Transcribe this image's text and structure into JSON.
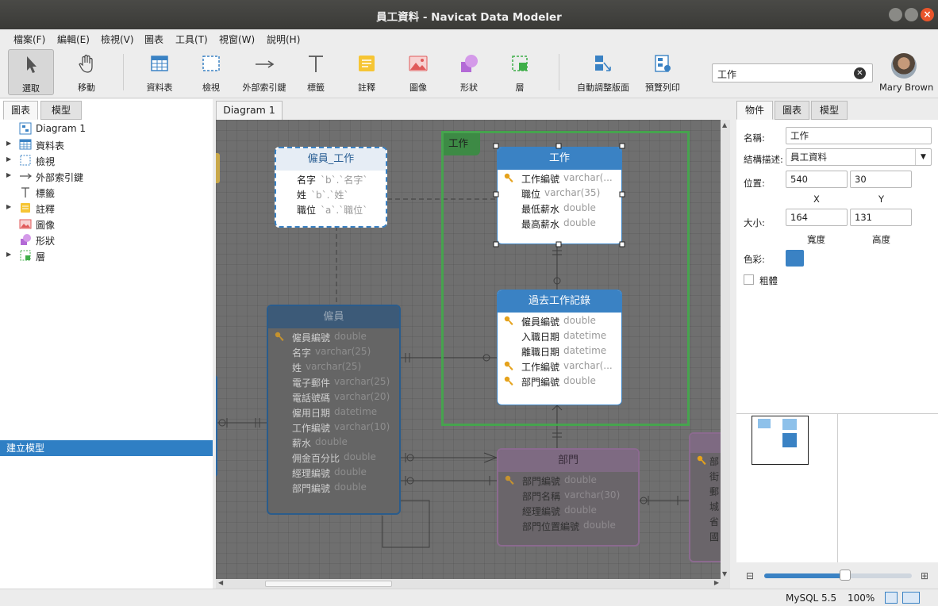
{
  "window": {
    "title": "員工資料 - Navicat Data Modeler"
  },
  "menu": [
    "檔案(F)",
    "編輯(E)",
    "檢視(V)",
    "圖表",
    "工具(T)",
    "視窗(W)",
    "說明(H)"
  ],
  "toolbar": {
    "select": "選取",
    "move": "移動",
    "table": "資料表",
    "view": "檢視",
    "foreign_key": "外部索引鍵",
    "label": "標籤",
    "note": "註釋",
    "image": "圖像",
    "shape": "形狀",
    "layer": "層",
    "auto_layout": "自動調整版面",
    "print_preview": "預覽列印",
    "search_value": "工作",
    "user": "Mary Brown"
  },
  "left_panel": {
    "tabs": [
      "圖表",
      "模型"
    ],
    "tree": [
      {
        "label": "Diagram 1",
        "icon": "diagram-icon",
        "expandable": false
      },
      {
        "label": "資料表",
        "icon": "table-icon",
        "expandable": true
      },
      {
        "label": "檢視",
        "icon": "view-icon",
        "expandable": true
      },
      {
        "label": "外部索引鍵",
        "icon": "foreign-key-icon",
        "expandable": true
      },
      {
        "label": "標籤",
        "icon": "label-icon",
        "expandable": false
      },
      {
        "label": "註釋",
        "icon": "note-icon",
        "expandable": true
      },
      {
        "label": "圖像",
        "icon": "image-icon",
        "expandable": false
      },
      {
        "label": "形狀",
        "icon": "shape-icon",
        "expandable": false
      },
      {
        "label": "層",
        "icon": "layer-icon",
        "expandable": true
      }
    ],
    "selected_item": "建立模型"
  },
  "document_tab": "Diagram 1",
  "diagram": {
    "layer_label": "工作",
    "entities": {
      "employee_job": {
        "title": "僱員_工作",
        "fields": [
          {
            "name": "名字",
            "type": "`b`.`名字`"
          },
          {
            "name": "姓",
            "type": "`b`.`姓`"
          },
          {
            "name": "職位",
            "type": "`a`.`職位`"
          }
        ]
      },
      "job": {
        "title": "工作",
        "fields": [
          {
            "name": "工作編號",
            "type": "varchar(...",
            "key": true
          },
          {
            "name": "職位",
            "type": "varchar(35)",
            "key": false
          },
          {
            "name": "最低薪水",
            "type": "double",
            "key": false
          },
          {
            "name": "最高薪水",
            "type": "double",
            "key": false
          }
        ]
      },
      "job_history": {
        "title": "過去工作記錄",
        "fields": [
          {
            "name": "僱員編號",
            "type": "double",
            "key": true
          },
          {
            "name": "入職日期",
            "type": "datetime",
            "key": false
          },
          {
            "name": "離職日期",
            "type": "datetime",
            "key": false
          },
          {
            "name": "工作編號",
            "type": "varchar(...",
            "key": true
          },
          {
            "name": "部門編號",
            "type": "double",
            "key": true
          }
        ]
      },
      "employee": {
        "title": "僱員",
        "fields": [
          {
            "name": "僱員編號",
            "type": "double",
            "key": true
          },
          {
            "name": "名字",
            "type": "varchar(25)",
            "key": false
          },
          {
            "name": "姓",
            "type": "varchar(25)",
            "key": false
          },
          {
            "name": "電子郵件",
            "type": "varchar(25)",
            "key": false
          },
          {
            "name": "電話號碼",
            "type": "varchar(20)",
            "key": false
          },
          {
            "name": "僱用日期",
            "type": "datetime",
            "key": false
          },
          {
            "name": "工作編號",
            "type": "varchar(10)",
            "key": false
          },
          {
            "name": "薪水",
            "type": "double",
            "key": false
          },
          {
            "name": "佣金百分比",
            "type": "double",
            "key": false
          },
          {
            "name": "經理編號",
            "type": "double",
            "key": false
          },
          {
            "name": "部門編號",
            "type": "double",
            "key": false
          }
        ]
      },
      "department": {
        "title": "部門",
        "fields": [
          {
            "name": "部門編號",
            "type": "double",
            "key": true
          },
          {
            "name": "部門名稱",
            "type": "varchar(30)",
            "key": false
          },
          {
            "name": "經理編號",
            "type": "double",
            "key": false
          },
          {
            "name": "部門位置編號",
            "type": "double",
            "key": false
          }
        ]
      },
      "location_partial": {
        "fields": [
          "部",
          "街",
          "郵",
          "城",
          "省",
          "國"
        ]
      }
    }
  },
  "right_panel": {
    "tabs": [
      "物件",
      "圖表",
      "模型"
    ],
    "name_label": "名稱:",
    "name_value": "工作",
    "schema_label": "結構描述:",
    "schema_value": "員工資料",
    "position_label": "位置:",
    "pos_x": "540",
    "pos_y": "30",
    "x_label": "X",
    "y_label": "Y",
    "size_label": "大小:",
    "width": "164",
    "height": "131",
    "width_label": "寬度",
    "height_label": "高度",
    "color_label": "色彩:",
    "bold_label": "粗體",
    "zoom_percent": 55
  },
  "status": {
    "db": "MySQL 5.5",
    "zoom": "100%"
  },
  "colors": {
    "accent": "#3a82c4",
    "layer_border": "#3fae49",
    "note": "#f6c534"
  }
}
